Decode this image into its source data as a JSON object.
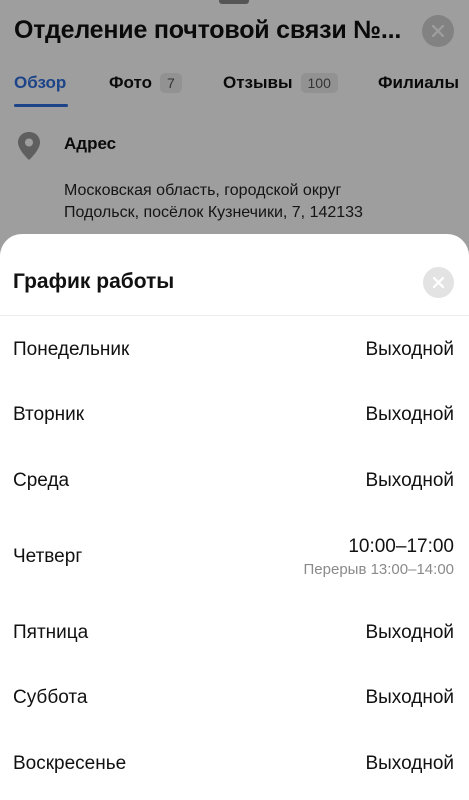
{
  "background": {
    "title": "Отделение почтовой связи №...",
    "tabs": [
      {
        "label": "Обзор",
        "active": true
      },
      {
        "label": "Фото",
        "count": "7"
      },
      {
        "label": "Отзывы",
        "count": "100"
      },
      {
        "label": "Филиалы"
      }
    ],
    "address": {
      "label": "Адрес",
      "line1": "Московская область, городской округ",
      "line2": "Подольск, посёлок Кузнечики, 7,  142133"
    },
    "icons": {
      "close": "close-icon",
      "address": "map-pin-icon"
    }
  },
  "sheet": {
    "title": "График работы",
    "close_icon": "close-icon",
    "days": [
      {
        "day": "Понедельник",
        "hours": "Выходной"
      },
      {
        "day": "Вторник",
        "hours": "Выходной"
      },
      {
        "day": "Среда",
        "hours": "Выходной"
      },
      {
        "day": "Четверг",
        "hours": "10:00–17:00",
        "break": "Перерыв 13:00–14:00"
      },
      {
        "day": "Пятница",
        "hours": "Выходной"
      },
      {
        "day": "Суббота",
        "hours": "Выходной"
      },
      {
        "day": "Воскресенье",
        "hours": "Выходной"
      }
    ]
  },
  "colors": {
    "accent": "#2f6fde",
    "overlay": "rgba(0,0,0,0.38)"
  }
}
